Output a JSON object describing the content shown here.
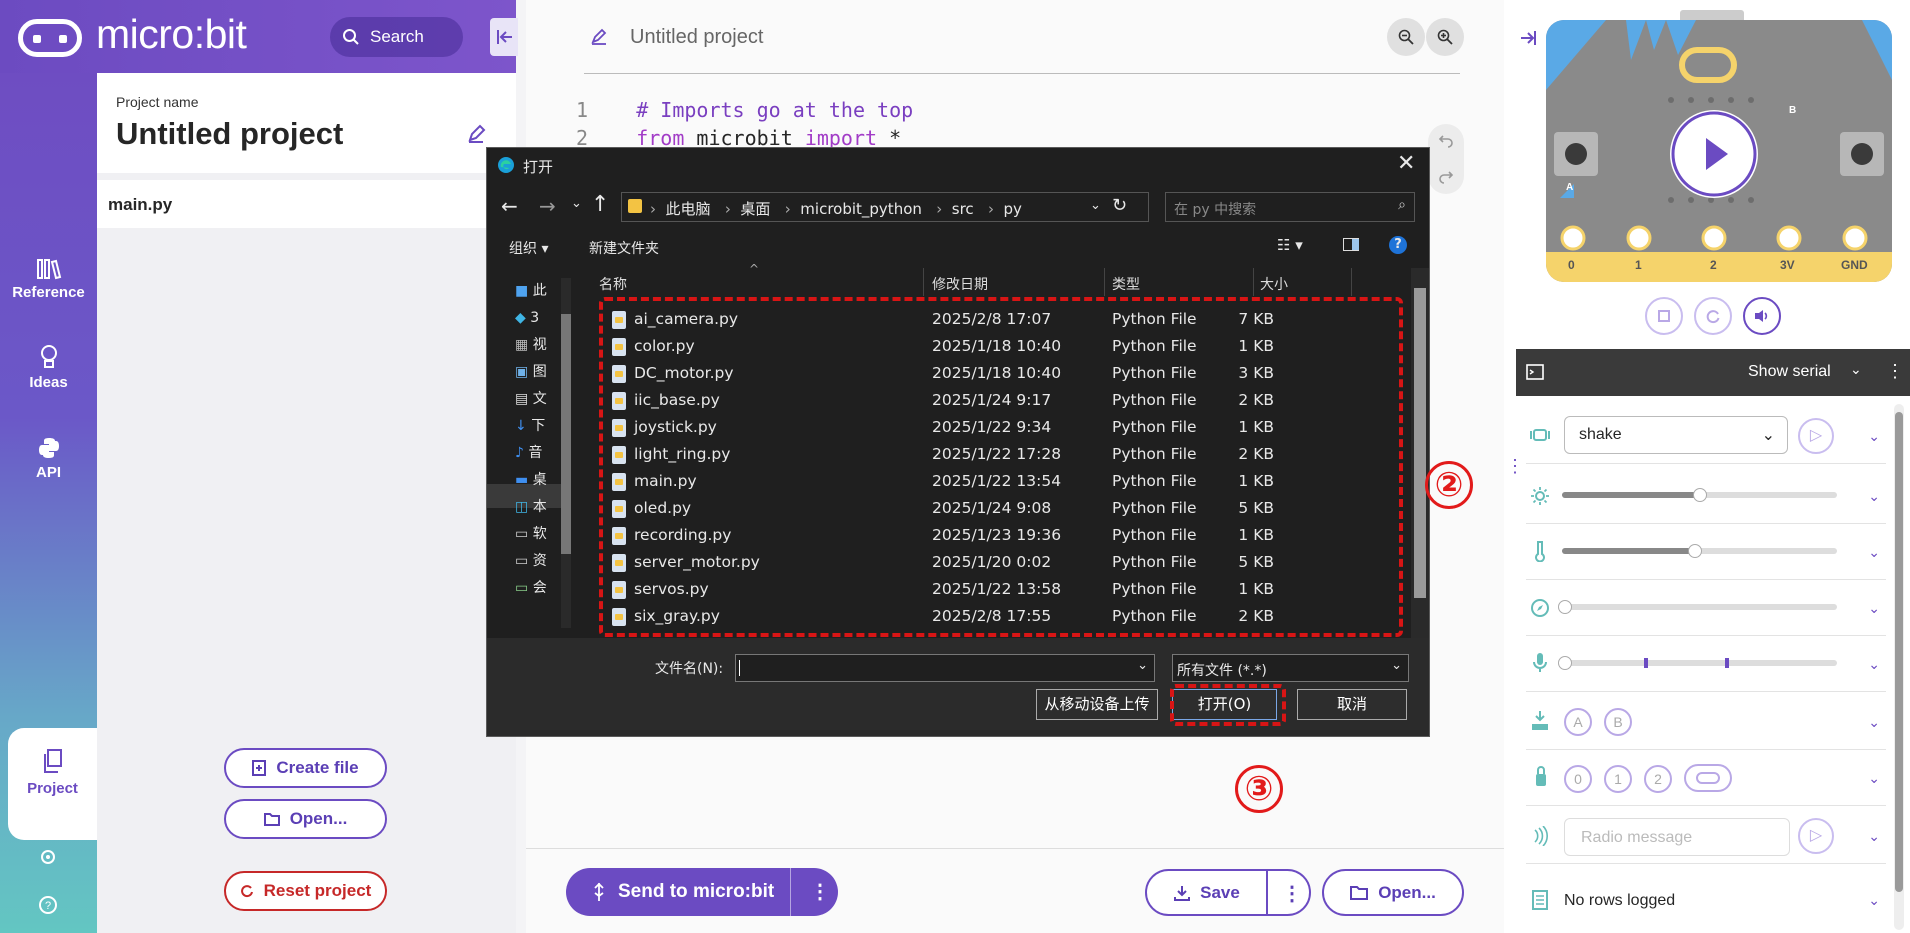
{
  "header": {
    "logo_text": "micro:bit",
    "search_placeholder": "Search"
  },
  "rail": {
    "reference": "Reference",
    "ideas": "Ideas",
    "api": "API",
    "project": "Project"
  },
  "project": {
    "name_label": "Project name",
    "title": "Untitled project",
    "file": "main.py",
    "create_file": "Create file",
    "open": "Open...",
    "reset": "Reset project"
  },
  "editor": {
    "title": "Untitled project",
    "lines": [
      {
        "num": "1",
        "text": "# Imports go at the top"
      },
      {
        "num": "2",
        "kw1": "from",
        "mod": " microbit ",
        "kw2": "import",
        "rest": " *"
      }
    ],
    "send": "Send to micro:bit",
    "save": "Save",
    "open": "Open..."
  },
  "simulator": {
    "pins": [
      "0",
      "1",
      "2",
      "3V",
      "GND"
    ],
    "button_a": "A",
    "button_b": "B",
    "show_serial": "Show serial",
    "gesture": "shake",
    "buttons": [
      "A",
      "B"
    ],
    "touch_pins": [
      "0",
      "1",
      "2"
    ],
    "radio_placeholder": "Radio message",
    "log": "No rows logged"
  },
  "dialog": {
    "title": "打开",
    "breadcrumb": [
      "此电脑",
      "桌面",
      "microbit_python",
      "src",
      "py"
    ],
    "search_placeholder": "在 py 中搜索",
    "organize": "组织 ▾",
    "new_folder": "新建文件夹",
    "columns": {
      "name": "名称",
      "date": "修改日期",
      "type": "类型",
      "size": "大小"
    },
    "tree": [
      "此",
      "3",
      "视",
      "图",
      "文",
      "下",
      "音",
      "桌",
      "本",
      "软",
      "资",
      "会"
    ],
    "files": [
      {
        "name": "ai_camera.py",
        "date": "2025/2/8 17:07",
        "type": "Python File",
        "size": "7 KB"
      },
      {
        "name": "color.py",
        "date": "2025/1/18 10:40",
        "type": "Python File",
        "size": "1 KB"
      },
      {
        "name": "DC_motor.py",
        "date": "2025/1/18 10:40",
        "type": "Python File",
        "size": "3 KB"
      },
      {
        "name": "iic_base.py",
        "date": "2025/1/24 9:17",
        "type": "Python File",
        "size": "2 KB"
      },
      {
        "name": "joystick.py",
        "date": "2025/1/22 9:34",
        "type": "Python File",
        "size": "1 KB"
      },
      {
        "name": "light_ring.py",
        "date": "2025/1/22 17:28",
        "type": "Python File",
        "size": "2 KB"
      },
      {
        "name": "main.py",
        "date": "2025/1/22 13:54",
        "type": "Python File",
        "size": "1 KB"
      },
      {
        "name": "oled.py",
        "date": "2025/1/24 9:08",
        "type": "Python File",
        "size": "5 KB"
      },
      {
        "name": "recording.py",
        "date": "2025/1/23 19:36",
        "type": "Python File",
        "size": "1 KB"
      },
      {
        "name": "server_motor.py",
        "date": "2025/1/20 0:02",
        "type": "Python File",
        "size": "5 KB"
      },
      {
        "name": "servos.py",
        "date": "2025/1/22 13:58",
        "type": "Python File",
        "size": "1 KB"
      },
      {
        "name": "six_gray.py",
        "date": "2025/2/8 17:55",
        "type": "Python File",
        "size": "2 KB"
      }
    ],
    "filename_label": "文件名(N):",
    "filetype": "所有文件 (*.*)",
    "upload_mobile": "从移动设备上传",
    "open": "打开(O)",
    "cancel": "取消"
  },
  "annotations": {
    "two": "②",
    "three": "③"
  },
  "colors": {
    "brand": "#6b4bc2",
    "annotation_red": "#d81515"
  }
}
